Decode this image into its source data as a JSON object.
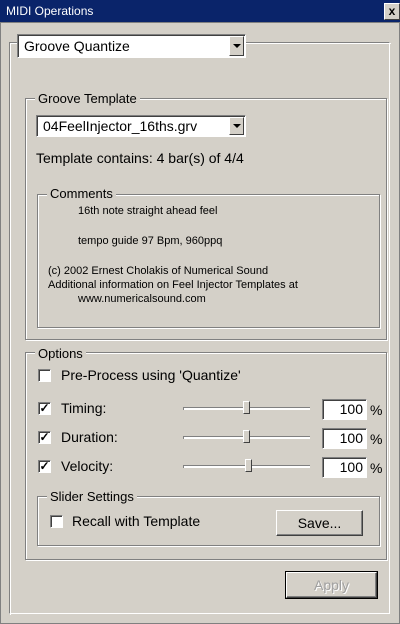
{
  "window": {
    "title": "MIDI Operations",
    "close_glyph": "x"
  },
  "operation": {
    "selected": "Groove Quantize"
  },
  "groove_template": {
    "legend": "Groove Template",
    "file": "04FeelInjector_16ths.grv",
    "contains_text": "Template contains: 4 bar(s) of 4/4",
    "comments": {
      "legend": "Comments",
      "lines": [
        "16th note straight ahead feel",
        "tempo guide 97 Bpm, 960ppq",
        "(c) 2002  Ernest Cholakis of Numerical Sound",
        "Additional information on Feel Injector Templates at",
        "www.numericalsound.com"
      ]
    }
  },
  "options": {
    "legend": "Options",
    "preprocess": {
      "label": "Pre-Process using 'Quantize'",
      "checked": false
    },
    "rows": [
      {
        "label": "Timing:",
        "checked": true,
        "value": "100",
        "unit": "%",
        "level": 0.5
      },
      {
        "label": "Duration:",
        "checked": true,
        "value": "100",
        "unit": "%",
        "level": 0.5
      },
      {
        "label": "Velocity:",
        "checked": true,
        "value": "100",
        "unit": "%",
        "level": 0.5
      }
    ],
    "slider_settings": {
      "legend": "Slider Settings",
      "recall": {
        "label": "Recall with Template",
        "checked": false
      },
      "save_label": "Save..."
    }
  },
  "apply_label": "Apply",
  "colors": {
    "titlebar": "#0a246a",
    "face": "#d4d0c8"
  }
}
